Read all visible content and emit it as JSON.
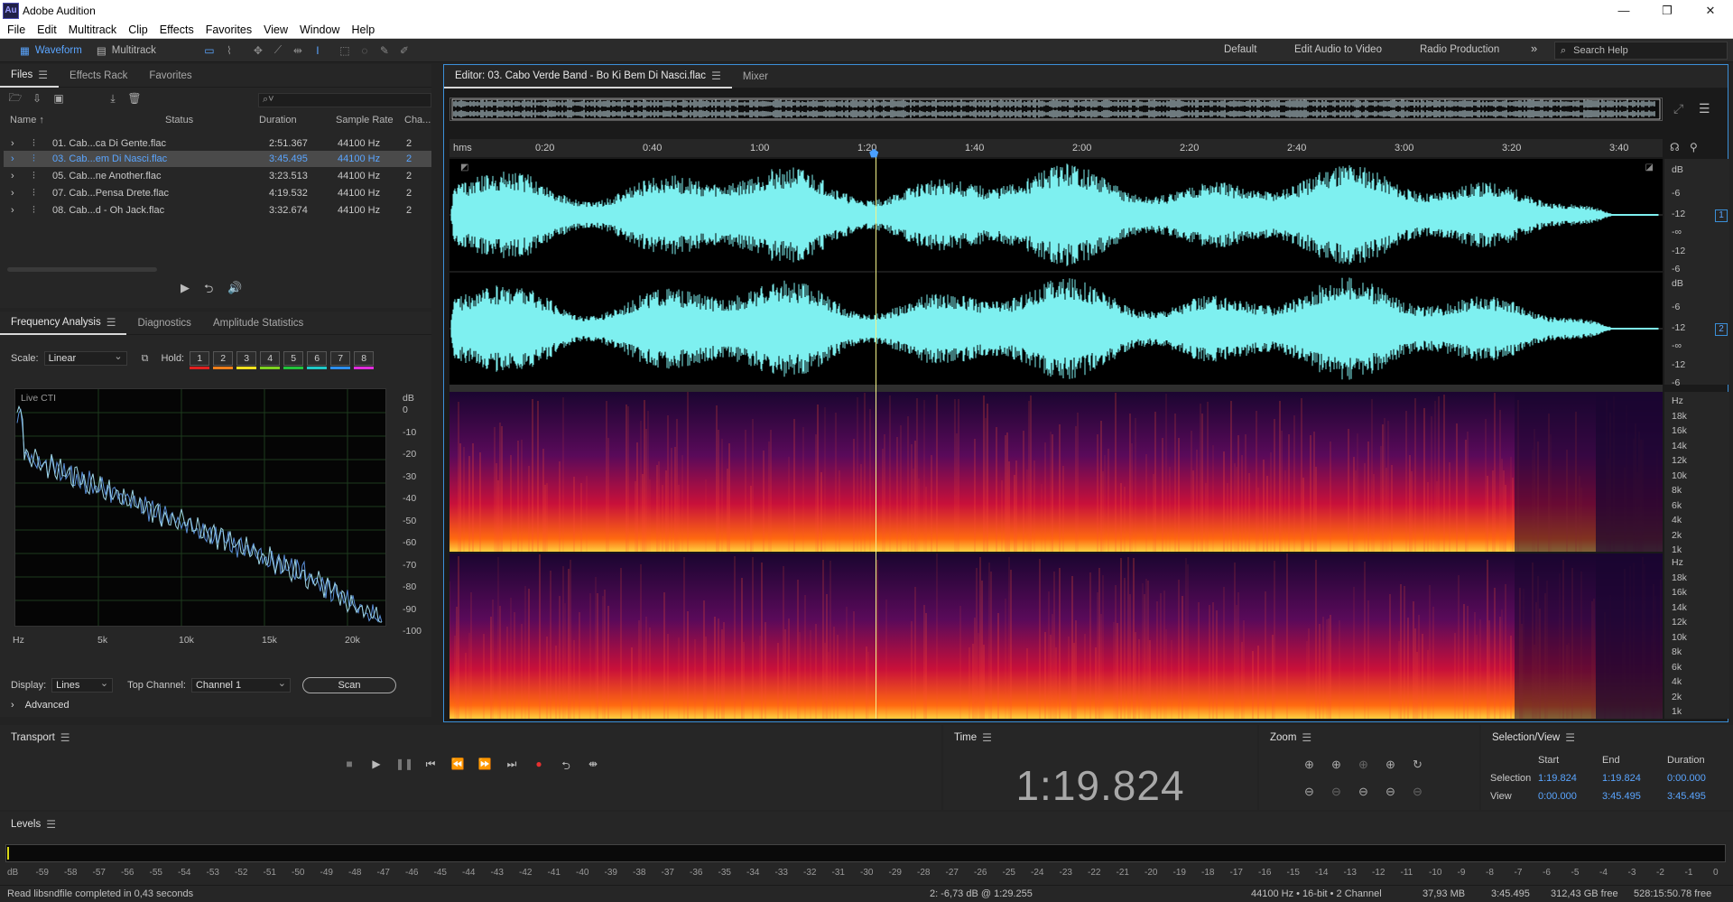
{
  "app": {
    "title": "Adobe Audition",
    "logo": "Au"
  },
  "window_controls": {
    "minimize": "—",
    "restore": "❐",
    "close": "✕"
  },
  "menu": [
    "File",
    "Edit",
    "Multitrack",
    "Clip",
    "Effects",
    "Favorites",
    "View",
    "Window",
    "Help"
  ],
  "toolbar": {
    "waveform_label": "Waveform",
    "multitrack_label": "Multitrack",
    "workspaces": [
      "Default",
      "Edit Audio to Video",
      "Radio Production"
    ],
    "more": "»",
    "search_placeholder": "Search Help"
  },
  "files_panel": {
    "tabs": [
      "Files",
      "Effects Rack",
      "Favorites"
    ],
    "columns": [
      "Name ↑",
      "Status",
      "Duration",
      "Sample Rate",
      "Cha..."
    ],
    "rows": [
      {
        "name": "01. Cab...ca Di Gente.flac",
        "duration": "2:51.367",
        "rate": "44100 Hz",
        "ch": "2"
      },
      {
        "name": "03. Cab...em Di Nasci.flac",
        "duration": "3:45.495",
        "rate": "44100 Hz",
        "ch": "2",
        "selected": true
      },
      {
        "name": "05. Cab...ne Another.flac",
        "duration": "3:23.513",
        "rate": "44100 Hz",
        "ch": "2"
      },
      {
        "name": "07. Cab...Pensa Drete.flac",
        "duration": "4:19.532",
        "rate": "44100 Hz",
        "ch": "2"
      },
      {
        "name": "08. Cab...d - Oh Jack.flac",
        "duration": "3:32.674",
        "rate": "44100 Hz",
        "ch": "2"
      }
    ]
  },
  "frequency_panel": {
    "tabs": [
      "Frequency Analysis",
      "Diagnostics",
      "Amplitude Statistics"
    ],
    "scale_label": "Scale:",
    "scale_value": "Linear",
    "hold_label": "Hold:",
    "hold_buttons": [
      "1",
      "2",
      "3",
      "4",
      "5",
      "6",
      "7",
      "8"
    ],
    "hold_colors": [
      "#e0201f",
      "#f07f1c",
      "#f2e21f",
      "#7ed321",
      "#22c43c",
      "#1fc9c7",
      "#2d8ff0",
      "#e02ddc"
    ],
    "graph_label": "Live CTI",
    "db_label": "dB",
    "db_ticks": [
      "0",
      "-10",
      "-20",
      "-30",
      "-40",
      "-50",
      "-60",
      "-70",
      "-80",
      "-90",
      "-100"
    ],
    "hz_ticks": [
      "Hz",
      "5k",
      "10k",
      "15k",
      "20k"
    ],
    "display_label": "Display:",
    "display_value": "Lines",
    "top_channel_label": "Top Channel:",
    "top_channel_value": "Channel 1",
    "scan_label": "Scan",
    "advanced_label": "Advanced"
  },
  "editor": {
    "tab_label": "Editor: 03. Cabo Verde Band - Bo Ki Bem Di Nasci.flac",
    "mixer_label": "Mixer",
    "ruler_labels": [
      "hms",
      "0:20",
      "0:40",
      "1:00",
      "1:20",
      "1:40",
      "2:00",
      "2:20",
      "2:40",
      "3:00",
      "3:20",
      "3:40"
    ],
    "db_scale": [
      "dB",
      "-6",
      "-12",
      "-∞",
      "-12",
      "-6"
    ],
    "channel_badges": [
      "1",
      "2"
    ],
    "hz_scale": [
      "Hz",
      "18k",
      "16k",
      "14k",
      "12k",
      "10k",
      "8k",
      "6k",
      "4k",
      "2k",
      "1k"
    ],
    "wave_color": "#7ef0f0"
  },
  "transport": {
    "title": "Transport"
  },
  "time_panel": {
    "title": "Time",
    "value": "1:19.824"
  },
  "zoom_panel": {
    "title": "Zoom"
  },
  "selection_view": {
    "title": "Selection/View",
    "cols": [
      "Start",
      "End",
      "Duration"
    ],
    "selection": {
      "label": "Selection",
      "start": "1:19.824",
      "end": "1:19.824",
      "duration": "0:00.000"
    },
    "view": {
      "label": "View",
      "start": "0:00.000",
      "end": "3:45.495",
      "duration": "3:45.495"
    }
  },
  "levels": {
    "title": "Levels",
    "ticks": [
      "dB",
      "-59",
      "-58",
      "-57",
      "-56",
      "-55",
      "-54",
      "-53",
      "-52",
      "-51",
      "-50",
      "-49",
      "-48",
      "-47",
      "-46",
      "-45",
      "-44",
      "-43",
      "-42",
      "-41",
      "-40",
      "-39",
      "-38",
      "-37",
      "-36",
      "-35",
      "-34",
      "-33",
      "-32",
      "-31",
      "-30",
      "-29",
      "-28",
      "-27",
      "-26",
      "-25",
      "-24",
      "-23",
      "-22",
      "-21",
      "-20",
      "-19",
      "-18",
      "-17",
      "-16",
      "-15",
      "-14",
      "-13",
      "-12",
      "-11",
      "-10",
      "-9",
      "-8",
      "-7",
      "-6",
      "-5",
      "-4",
      "-3",
      "-2",
      "-1",
      "0"
    ]
  },
  "status": {
    "message": "Read libsndfile completed in 0,43 seconds",
    "cursor": "2: -6,73 dB @ 1:29.255",
    "format": "44100 Hz • 16-bit • 2 Channel",
    "size": "37,93 MB",
    "duration": "3:45.495",
    "free": "312,43 GB free",
    "free_time": "528:15:50.78 free"
  }
}
